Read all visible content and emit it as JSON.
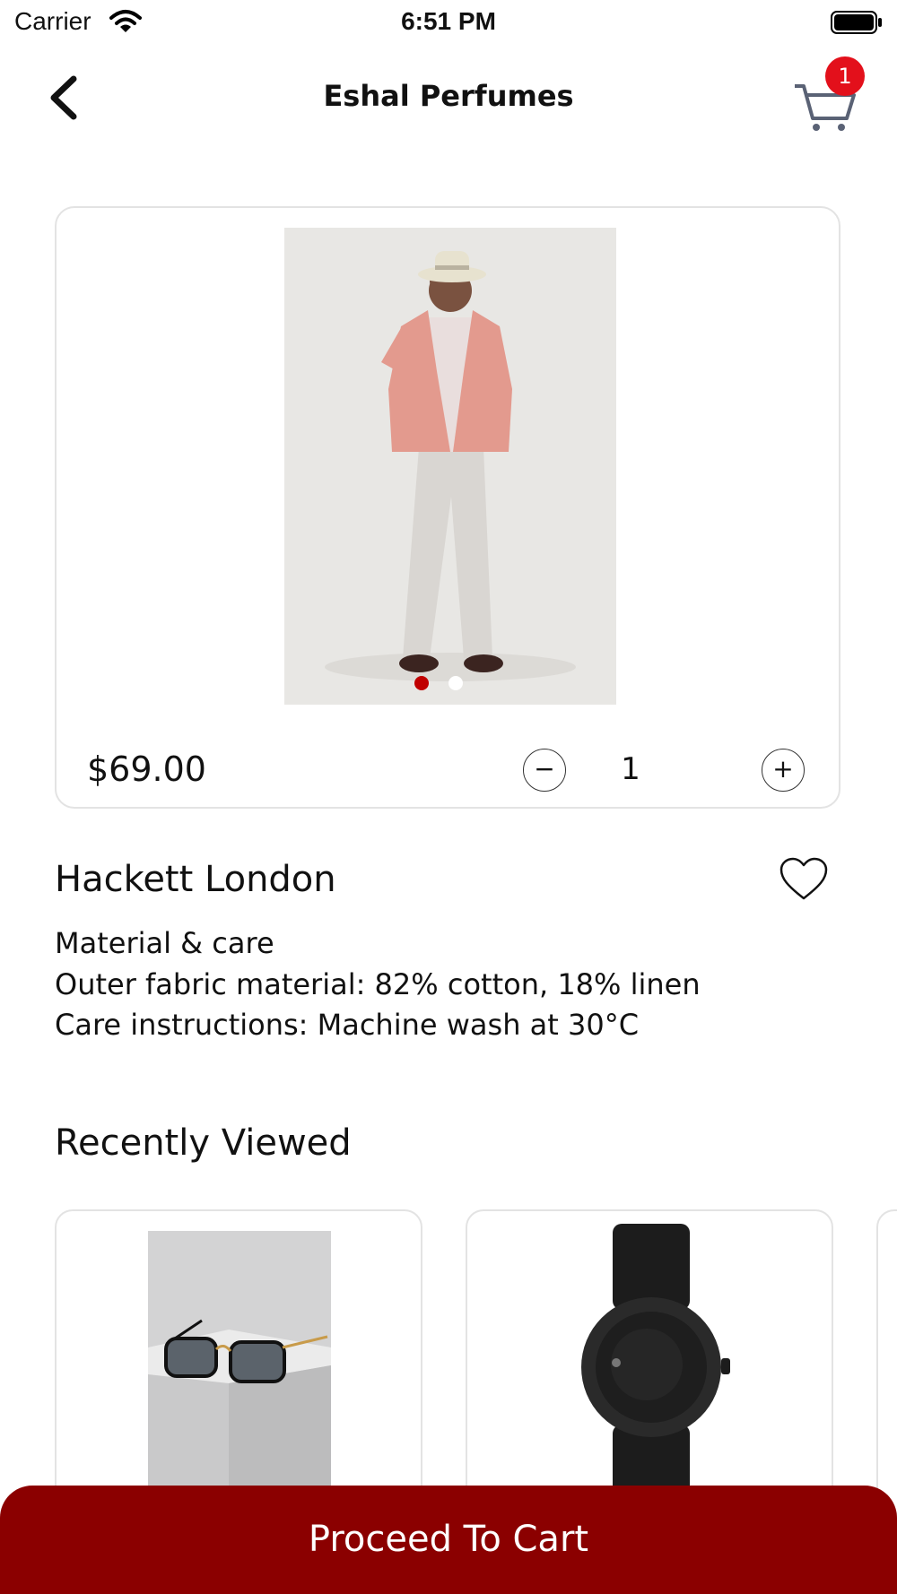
{
  "status_bar": {
    "carrier": "Carrier",
    "time": "6:51 PM"
  },
  "nav": {
    "title": "Eshal Perfumes",
    "cart_badge": "1",
    "icons": [
      "back-chevron-icon",
      "cart-icon"
    ]
  },
  "product": {
    "price": "$69.00",
    "quantity": "1",
    "minus_symbol": "−",
    "plus_symbol": "+",
    "name": "Hackett London",
    "description": [
      "Material & care",
      "Outer fabric material: 82% cotton, 18% linen",
      "Care instructions: Machine wash at 30°C"
    ],
    "image_count": 2,
    "active_image_index": 0
  },
  "recently_viewed": {
    "title": "Recently Viewed",
    "items": [
      "sunglasses",
      "watch"
    ]
  },
  "footer": {
    "proceed_label": "Proceed To Cart"
  },
  "colors": {
    "accent": "#8b0000",
    "badge": "#e3101b",
    "active_dot": "#c00000"
  }
}
